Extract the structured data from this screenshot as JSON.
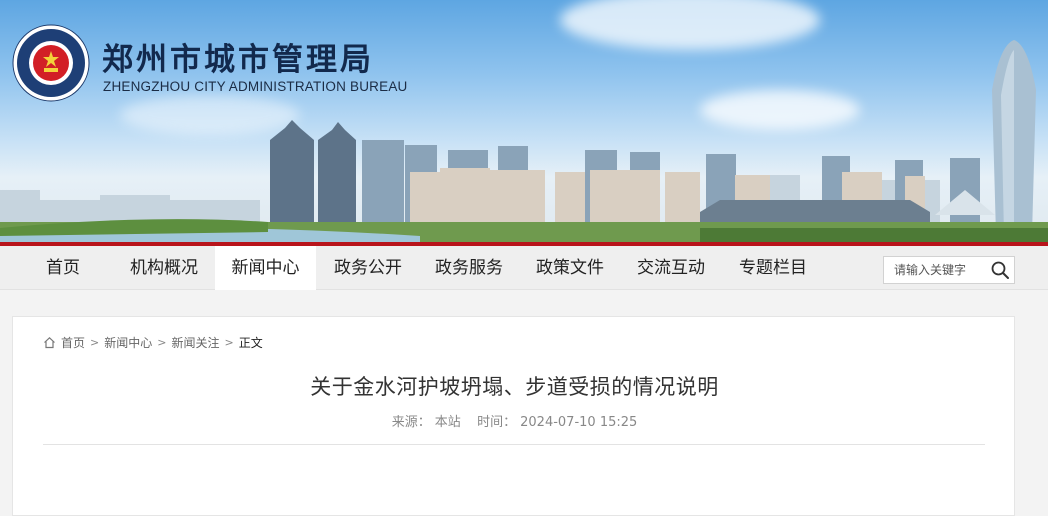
{
  "header": {
    "title": "郑州市城市管理局",
    "subtitle": "ZHENGZHOU CITY ADMINISTRATION BUREAU",
    "logo_icon": "emblem-seal-icon"
  },
  "nav": {
    "items": [
      {
        "label": "首页"
      },
      {
        "label": "机构概况"
      },
      {
        "label": "新闻中心"
      },
      {
        "label": "政务公开"
      },
      {
        "label": "政务服务"
      },
      {
        "label": "政策文件"
      },
      {
        "label": "交流互动"
      },
      {
        "label": "专题栏目"
      }
    ],
    "active_index": 2,
    "search": {
      "placeholder": "请输入关键字",
      "icon": "search-icon"
    }
  },
  "breadcrumb": {
    "items": [
      "首页",
      "新闻中心",
      "新闻关注",
      "正文"
    ],
    "separator": ">"
  },
  "article": {
    "title": "关于金水河护坡坍塌、步道受损的情况说明",
    "source_label": "来源：",
    "source": "本站",
    "time_label": "时间：",
    "time": "2024-07-10 15:25"
  },
  "colors": {
    "accent_red": "#b8141b",
    "title_navy": "#12294d"
  }
}
